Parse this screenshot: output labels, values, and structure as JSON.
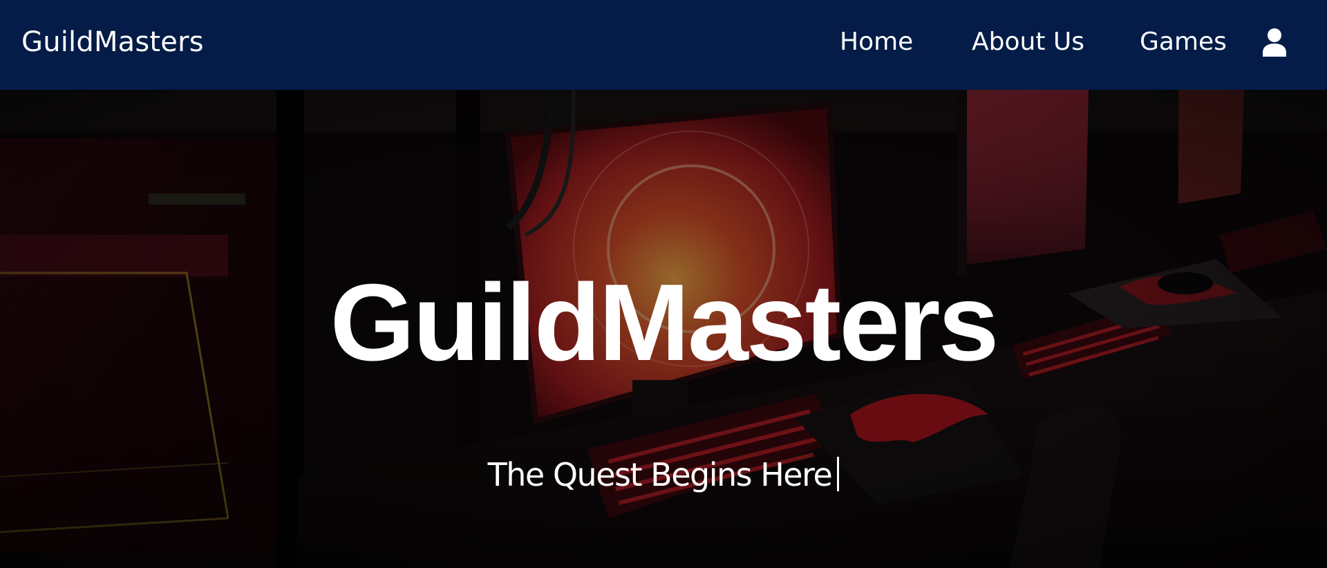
{
  "navbar": {
    "brand": "GuildMasters",
    "links": [
      {
        "label": "Home"
      },
      {
        "label": "About Us"
      },
      {
        "label": "Games"
      }
    ],
    "user_icon": "user-icon",
    "background_color": "#041c47"
  },
  "hero": {
    "title": "GuildMasters",
    "tagline": "The Quest Begins Here",
    "caret_visible": true,
    "background_image": "dark gaming room with monitors and red-lit keyboards",
    "accent_color": "#c81e2a"
  }
}
